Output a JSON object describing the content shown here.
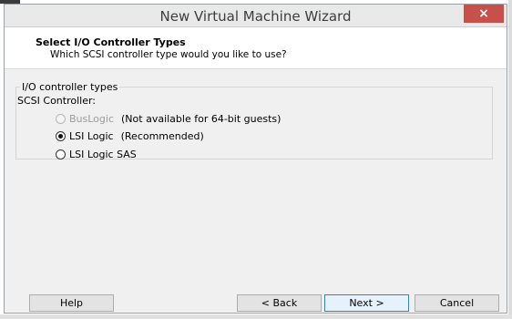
{
  "window": {
    "title": "New Virtual Machine Wizard",
    "close_symbol": "×"
  },
  "header": {
    "title": "Select I/O Controller Types",
    "subtitle": "Which SCSI controller type would you like to use?"
  },
  "group": {
    "legend": "I/O controller types",
    "scsi_label": "SCSI Controller:"
  },
  "options": [
    {
      "label": "BusLogic",
      "note": "(Not available for 64-bit guests)",
      "selected": false,
      "enabled": false
    },
    {
      "label": "LSI Logic",
      "note": "(Recommended)",
      "selected": true,
      "enabled": true
    },
    {
      "label": "LSI Logic SAS",
      "note": "",
      "selected": false,
      "enabled": true
    }
  ],
  "buttons": {
    "help": "Help",
    "back": "< Back",
    "next": "Next >",
    "cancel": "Cancel"
  }
}
